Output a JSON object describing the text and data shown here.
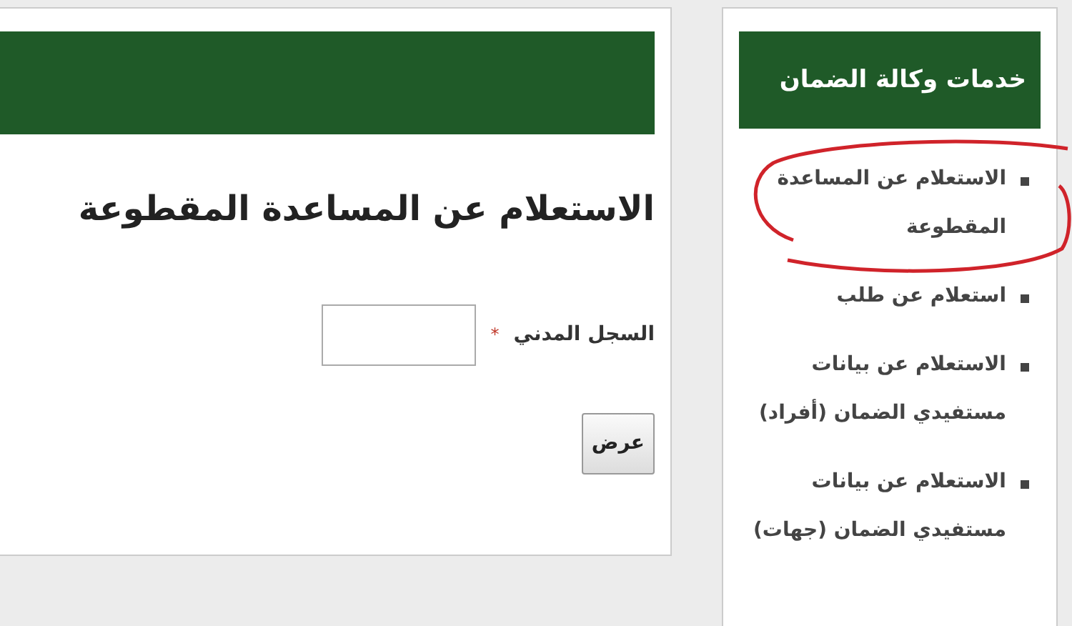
{
  "sidebar": {
    "title": "خدمات وكالة الضمان",
    "items": [
      {
        "label": "الاستعلام عن المساعدة المقطوعة",
        "circled": true
      },
      {
        "label": "استعلام عن طلب",
        "circled": false
      },
      {
        "label": "الاستعلام عن بيانات مستفيدي الضمان (أفراد)",
        "circled": false
      },
      {
        "label": "الاستعلام عن بيانات مستفيدي الضمان (جهات)",
        "circled": false
      }
    ]
  },
  "main": {
    "title": "الاستعلام عن المساعدة المقطوعة",
    "form": {
      "label": "السجل المدني",
      "required_mark": "*",
      "button": "عرض"
    }
  }
}
